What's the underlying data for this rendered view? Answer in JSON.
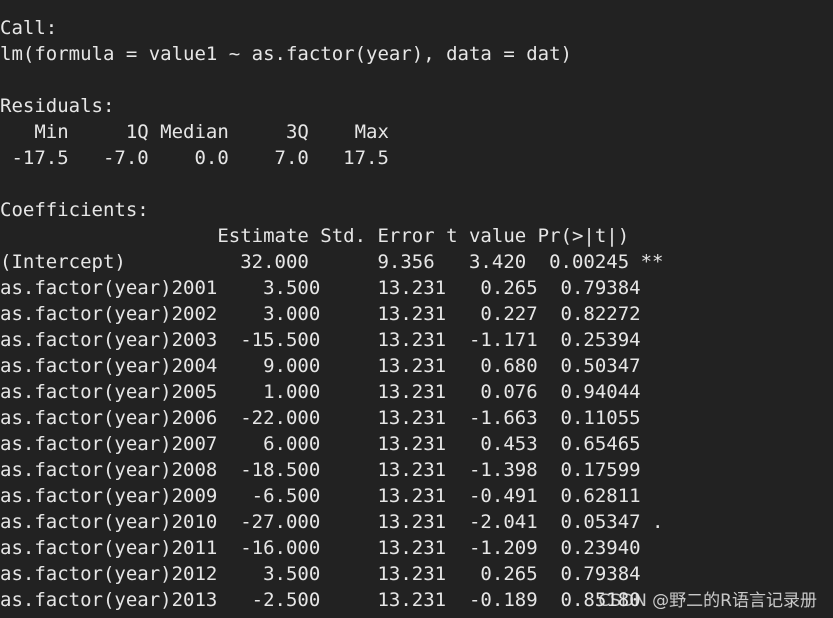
{
  "console": {
    "lines": [
      "Call:",
      "lm(formula = value1 ~ as.factor(year), data = dat)",
      "",
      "Residuals:",
      "   Min     1Q Median     3Q    Max ",
      " -17.5   -7.0    0.0    7.0   17.5 ",
      "",
      "Coefficients:",
      "                   Estimate Std. Error t value Pr(>|t|)   ",
      "(Intercept)          32.000      9.356   3.420  0.00245 **",
      "as.factor(year)2001    3.500     13.231   0.265  0.79384   ",
      "as.factor(year)2002    3.000     13.231   0.227  0.82272   ",
      "as.factor(year)2003  -15.500     13.231  -1.171  0.25394   ",
      "as.factor(year)2004    9.000     13.231   0.680  0.50347   ",
      "as.factor(year)2005    1.000     13.231   0.076  0.94044   ",
      "as.factor(year)2006  -22.000     13.231  -1.663  0.11055   ",
      "as.factor(year)2007    6.000     13.231   0.453  0.65465   ",
      "as.factor(year)2008  -18.500     13.231  -1.398  0.17599   ",
      "as.factor(year)2009   -6.500     13.231  -0.491  0.62811   ",
      "as.factor(year)2010  -27.000     13.231  -2.041  0.05347 . ",
      "as.factor(year)2011  -16.000     13.231  -1.209  0.23940   ",
      "as.factor(year)2012    3.500     13.231   0.265  0.79384   ",
      "as.factor(year)2013   -2.500     13.231  -0.189  0.85180   "
    ]
  },
  "watermark": {
    "text": "CSDN @野二的R语言记录册"
  },
  "colors": {
    "background": "#222222",
    "text": "#e6e6e6"
  }
}
